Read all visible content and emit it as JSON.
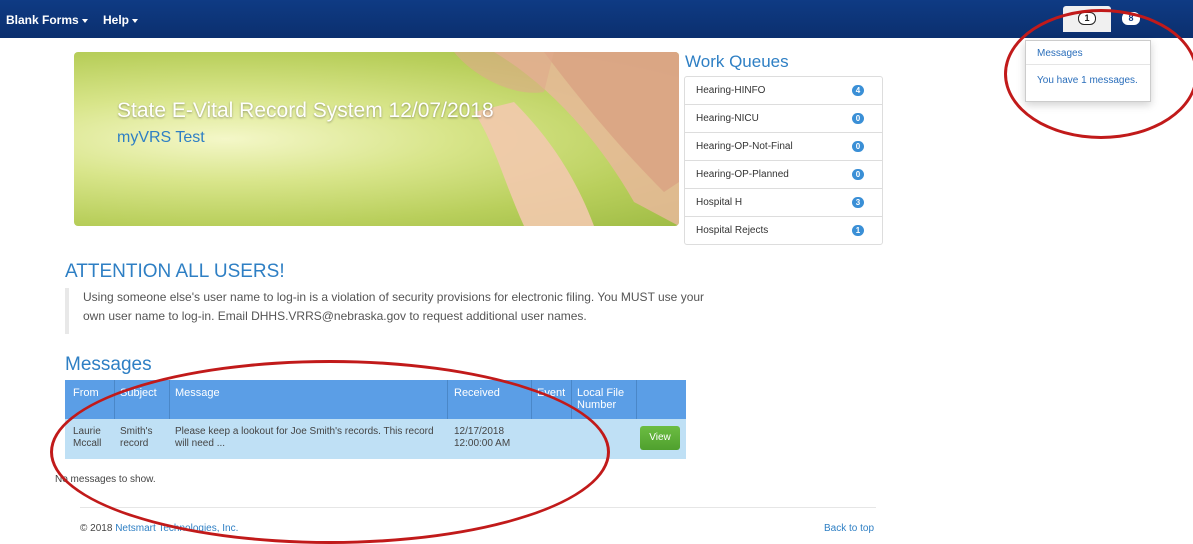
{
  "navbar": {
    "menus": [
      {
        "label": "Blank Forms"
      },
      {
        "label": "Help"
      }
    ],
    "messages_count": "1",
    "alerts_count": "8",
    "messages_icon": "speech-bubble-icon",
    "alerts_icon": "speech-bubble-icon"
  },
  "messages_dropdown": {
    "title": "Messages",
    "text": "You have 1 messages."
  },
  "banner": {
    "title": "State E-Vital Record System 12/07/2018",
    "subtitle": "myVRS Test"
  },
  "work_queues": {
    "title": "Work Queues",
    "items": [
      {
        "label": "Hearing-HINFO",
        "count": "4"
      },
      {
        "label": "Hearing-NICU",
        "count": "0"
      },
      {
        "label": "Hearing-OP-Not-Final",
        "count": "0"
      },
      {
        "label": "Hearing-OP-Planned",
        "count": "0"
      },
      {
        "label": "Hospital H",
        "count": "3"
      },
      {
        "label": "Hospital Rejects",
        "count": "1"
      }
    ]
  },
  "attention": {
    "title": "ATTENTION ALL USERS!",
    "body": "Using someone else's user name to log-in is a violation of security provisions for electronic filing. You MUST use your own user name to log-in. Email DHHS.VRRS@nebraska.gov to request additional user names."
  },
  "messages": {
    "title": "Messages",
    "columns": [
      "From",
      "Subject",
      "Message",
      "Received",
      "Event",
      "Local File Number"
    ],
    "rows": [
      {
        "from": "Laurie Mccall",
        "subject": "Smith's record",
        "message": "Please keep a lookout for Joe Smith's records. This record will need ...",
        "received": "12/17/2018 12:00:00 AM",
        "event": "",
        "local_file_number": "",
        "action": "View"
      }
    ],
    "empty_text": "No messages to show."
  },
  "footer": {
    "copyright": "© 2018",
    "company": "Netsmart Technologies, Inc.",
    "back_to_top": "Back to top"
  },
  "colors": {
    "navbar": "#0f3b84",
    "accent": "#2e7fc4",
    "table_header": "#5b9ee6",
    "table_row": "#bfe0f5",
    "view_button": "#5aaa35",
    "annotation": "#c11a1a"
  }
}
